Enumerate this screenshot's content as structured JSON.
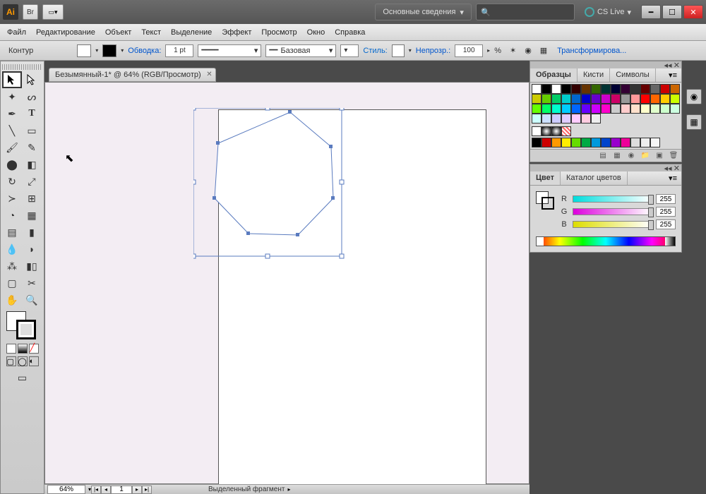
{
  "title_area": {
    "workspace": "Основные сведения",
    "search_placeholder": "",
    "cslive": "CS Live"
  },
  "menubar": [
    "Файл",
    "Редактирование",
    "Объект",
    "Текст",
    "Выделение",
    "Эффект",
    "Просмотр",
    "Окно",
    "Справка"
  ],
  "control": {
    "label": "Контур",
    "stroke_label": "Обводка:",
    "stroke_pt": "1 pt",
    "brush_label": "Базовая",
    "style_label": "Стиль:",
    "opacity_label": "Непрозр.:",
    "opacity": "100",
    "pct": "%",
    "transform": "Трансформирова..."
  },
  "doc_tab": "Безымянный-1* @ 64% (RGB/Просмотр)",
  "statusbar": {
    "zoom": "64%",
    "page": "1",
    "status": "Выделенный фрагмент"
  },
  "panels": {
    "swatches": {
      "tabs": [
        "Образцы",
        "Кисти",
        "Символы"
      ]
    },
    "color": {
      "tabs": [
        "Цвет",
        "Каталог цветов"
      ],
      "r": "255",
      "g": "255",
      "b": "255",
      "rl": "R",
      "gl": "G",
      "bl": "B"
    }
  },
  "swatch_colors": [
    "#ffffff",
    "#000000",
    "#ffffff",
    "#000000",
    "#330000",
    "#663300",
    "#336600",
    "#003333",
    "#000033",
    "#330033",
    "#333333",
    "#660000",
    "#666666",
    "#cc0000",
    "#cc6600",
    "#cccc00",
    "#66cc00",
    "#00cc66",
    "#00cccc",
    "#0066cc",
    "#0000cc",
    "#6600cc",
    "#cc00cc",
    "#cc0066",
    "#999999",
    "#ff9999",
    "#ff0000",
    "#ff6600",
    "#ffcc00",
    "#ccff00",
    "#66ff00",
    "#00ff66",
    "#00ffcc",
    "#00ccff",
    "#0066ff",
    "#6600ff",
    "#cc00ff",
    "#ff00cc",
    "#cccccc",
    "#ffcccc",
    "#ffe0cc",
    "#ffffcc",
    "#e0ffcc",
    "#ccffcc",
    "#ccffe0",
    "#ccffff",
    "#cce0ff",
    "#ccccff",
    "#e0ccff",
    "#ffccff",
    "#ffcce0",
    "#eeeeee"
  ],
  "swatch_row2": [
    "#000000",
    "#cc0000",
    "#ff9900",
    "#ffee00",
    "#66dd00",
    "#00aa44",
    "#0099dd",
    "#0044cc",
    "#9900cc",
    "#ee0099",
    "#dddddd",
    "#eeeeee",
    "#f6f6f6"
  ]
}
